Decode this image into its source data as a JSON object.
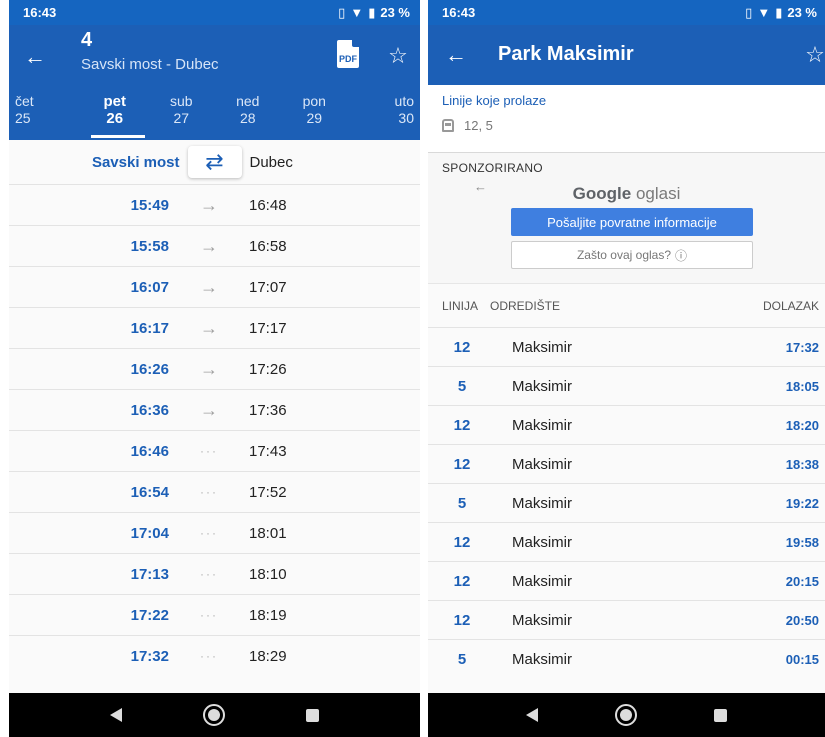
{
  "left": {
    "status": {
      "time": "16:43",
      "battery": "23 %"
    },
    "route": {
      "number": "4",
      "name": "Savski most - Dubec"
    },
    "days": [
      {
        "name": "čet",
        "num": "25"
      },
      {
        "name": "pet",
        "num": "26",
        "selected": true
      },
      {
        "name": "sub",
        "num": "27"
      },
      {
        "name": "ned",
        "num": "28"
      },
      {
        "name": "pon",
        "num": "29"
      },
      {
        "name": "uto",
        "num": "30"
      }
    ],
    "direction": {
      "from": "Savski most",
      "to": "Dubec"
    },
    "trips": [
      {
        "dep": "15:49",
        "arr": "16:48",
        "direct": true
      },
      {
        "dep": "15:58",
        "arr": "16:58",
        "direct": true
      },
      {
        "dep": "16:07",
        "arr": "17:07",
        "direct": true
      },
      {
        "dep": "16:17",
        "arr": "17:17",
        "direct": true
      },
      {
        "dep": "16:26",
        "arr": "17:26",
        "direct": true
      },
      {
        "dep": "16:36",
        "arr": "17:36",
        "direct": true
      },
      {
        "dep": "16:46",
        "arr": "17:43",
        "direct": false
      },
      {
        "dep": "16:54",
        "arr": "17:52",
        "direct": false
      },
      {
        "dep": "17:04",
        "arr": "18:01",
        "direct": false
      },
      {
        "dep": "17:13",
        "arr": "18:10",
        "direct": false
      },
      {
        "dep": "17:22",
        "arr": "18:19",
        "direct": false
      },
      {
        "dep": "17:32",
        "arr": "18:29",
        "direct": false
      }
    ]
  },
  "right": {
    "status": {
      "time": "16:43",
      "battery": "23 %"
    },
    "stop_title": "Park Maksimir",
    "lines_title": "Linije koje prolaze",
    "lines_value": "12, 5",
    "ad": {
      "label": "SPONZORIRANO",
      "brand_google": "Google",
      "brand_ads": "oglasi",
      "feedback_button": "Pošaljite povratne informacije",
      "why_button": "Zašto ovaj oglas?"
    },
    "table_headers": {
      "line": "LINIJA",
      "destination": "ODREDIŠTE",
      "arrival": "DOLAZAK"
    },
    "arrivals": [
      {
        "line": "12",
        "dest": "Maksimir",
        "time": "17:32"
      },
      {
        "line": "5",
        "dest": "Maksimir",
        "time": "18:05"
      },
      {
        "line": "12",
        "dest": "Maksimir",
        "time": "18:20"
      },
      {
        "line": "12",
        "dest": "Maksimir",
        "time": "18:38"
      },
      {
        "line": "5",
        "dest": "Maksimir",
        "time": "19:22"
      },
      {
        "line": "12",
        "dest": "Maksimir",
        "time": "19:58"
      },
      {
        "line": "12",
        "dest": "Maksimir",
        "time": "20:15"
      },
      {
        "line": "12",
        "dest": "Maksimir",
        "time": "20:50"
      },
      {
        "line": "5",
        "dest": "Maksimir",
        "time": "00:15"
      }
    ]
  },
  "icons": {
    "back": "arrow-left-icon",
    "favorite": "star-outline-icon",
    "pdf": "pdf-file-icon",
    "swap": "swap-arrows-icon",
    "direct": "arrow-right-icon",
    "via": "dots-icon",
    "bus": "bus-icon",
    "wifi": "wifi-icon",
    "battery": "battery-icon",
    "vibrate": "vibrate-icon"
  },
  "colors": {
    "primary": "#1c5fb6",
    "statusbar": "#1565c0",
    "ad_button": "#3f7fe0"
  }
}
